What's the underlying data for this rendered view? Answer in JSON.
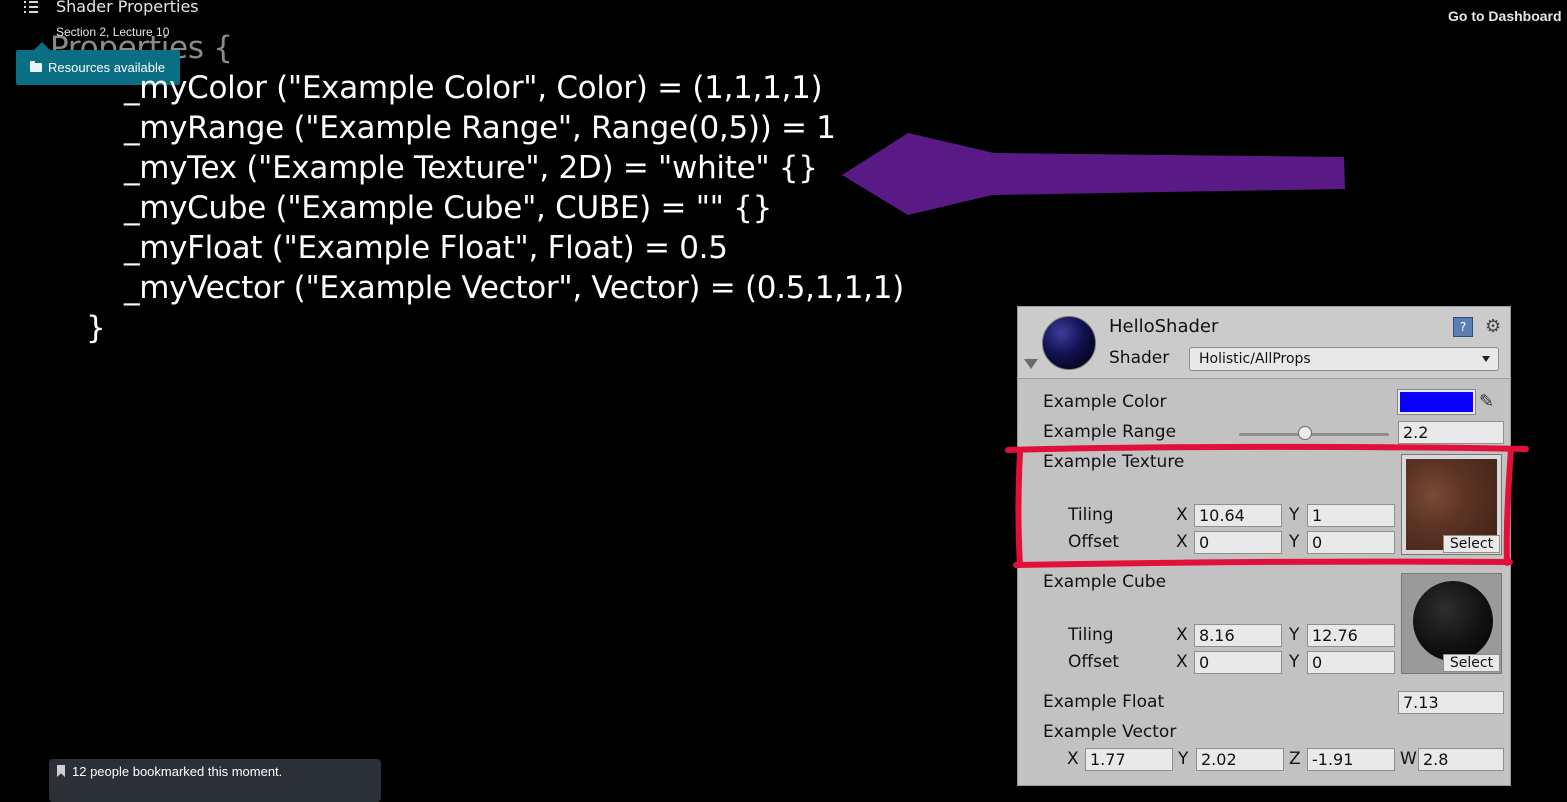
{
  "topbar": {
    "lecture_title": "Shader Properties",
    "lecture_subtitle": "Section 2, Lecture 10",
    "dashboard_link": "Go to Dashboard",
    "resources_label": "Resources available"
  },
  "slide": {
    "header": "Properties {",
    "lines": [
      "_myColor (\"Example Color\", Color) = (1,1,1,1)",
      "_myRange (\"Example Range\", Range(0,5)) = 1",
      "_myTex (\"Example Texture\", 2D) = \"white\" {}",
      "_myCube (\"Example Cube\", CUBE) = \"\" {}",
      "_myFloat (\"Example Float\", Float) = 0.5",
      "_myVector (\"Example Vector\", Vector) = (0.5,1,1,1)"
    ],
    "closing": "}",
    "arrow_color": "#5a1a86",
    "highlight_color": "#e0103a"
  },
  "inspector": {
    "material_name": "HelloShader",
    "shader_label": "Shader",
    "shader_value": "Holistic/AllProps",
    "color_label": "Example Color",
    "color_value": "#0a00ff",
    "range_label": "Example Range",
    "range_value": "2.2",
    "range_fraction": 0.44,
    "texture_label": "Example Texture",
    "texture_tiling_label": "Tiling",
    "texture_offset_label": "Offset",
    "texture_tiling_x": "10.64",
    "texture_tiling_y": "1",
    "texture_offset_x": "0",
    "texture_offset_y": "0",
    "texture_select": "Select",
    "cube_label": "Example Cube",
    "cube_tiling_label": "Tiling",
    "cube_offset_label": "Offset",
    "cube_tiling_x": "8.16",
    "cube_tiling_y": "12.76",
    "cube_offset_x": "0",
    "cube_offset_y": "0",
    "cube_select": "Select",
    "float_label": "Example Float",
    "float_value": "7.13",
    "vector_label": "Example Vector",
    "vector_x": "1.77",
    "vector_y": "2.02",
    "vector_z": "-1.91",
    "vector_w": "2.8",
    "axis_x": "X",
    "axis_y": "Y",
    "axis_z": "Z",
    "axis_w": "W"
  },
  "bookmark": {
    "text": "12 people bookmarked this moment."
  }
}
